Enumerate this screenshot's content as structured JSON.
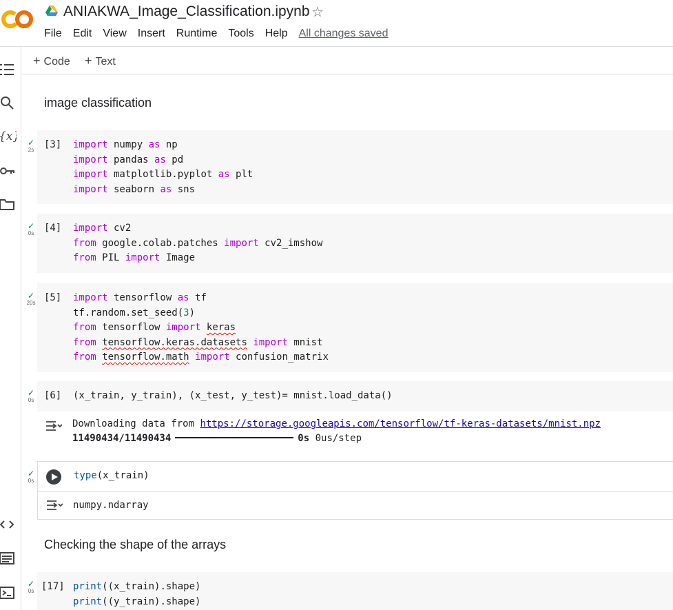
{
  "header": {
    "logo": "CO",
    "title": "ANIAKWA_Image_Classification.ipynb",
    "menu": [
      "File",
      "Edit",
      "View",
      "Insert",
      "Runtime",
      "Tools",
      "Help"
    ],
    "save_status": "All changes saved"
  },
  "toolbar": {
    "code_label": "Code",
    "text_label": "Text"
  },
  "left_rail": [
    "table-of-contents-icon",
    "search-icon",
    "variables-icon",
    "secrets-key-icon",
    "folder-icon",
    "code-snippets-icon",
    "command-palette-icon",
    "terminal-icon"
  ],
  "cells": {
    "text1": "image classification",
    "c3": {
      "count": "[3]",
      "time": "2s"
    },
    "c4": {
      "count": "[4]",
      "time": "0s"
    },
    "c5": {
      "count": "[5]",
      "time": "20s"
    },
    "c6": {
      "count": "[6]",
      "time": "0s",
      "out_prefix": "Downloading data from ",
      "out_url": "https://storage.googleapis.com/tensorflow/tf-keras-datasets/mnist.npz",
      "progress": "11490434/11490434",
      "progress_fraction": 1.0,
      "progress_time": "0s",
      "progress_rate": "0us/step"
    },
    "c7": {
      "time": "0s",
      "output": "numpy.ndarray"
    },
    "text2": "Checking the shape of the arrays",
    "c17": {
      "count": "[17]",
      "time": "0s"
    }
  },
  "colors": {
    "keyword": "#af00db",
    "function": "#0451a5",
    "number": "#098658",
    "link": "#1a0dab",
    "success": "#188038"
  }
}
